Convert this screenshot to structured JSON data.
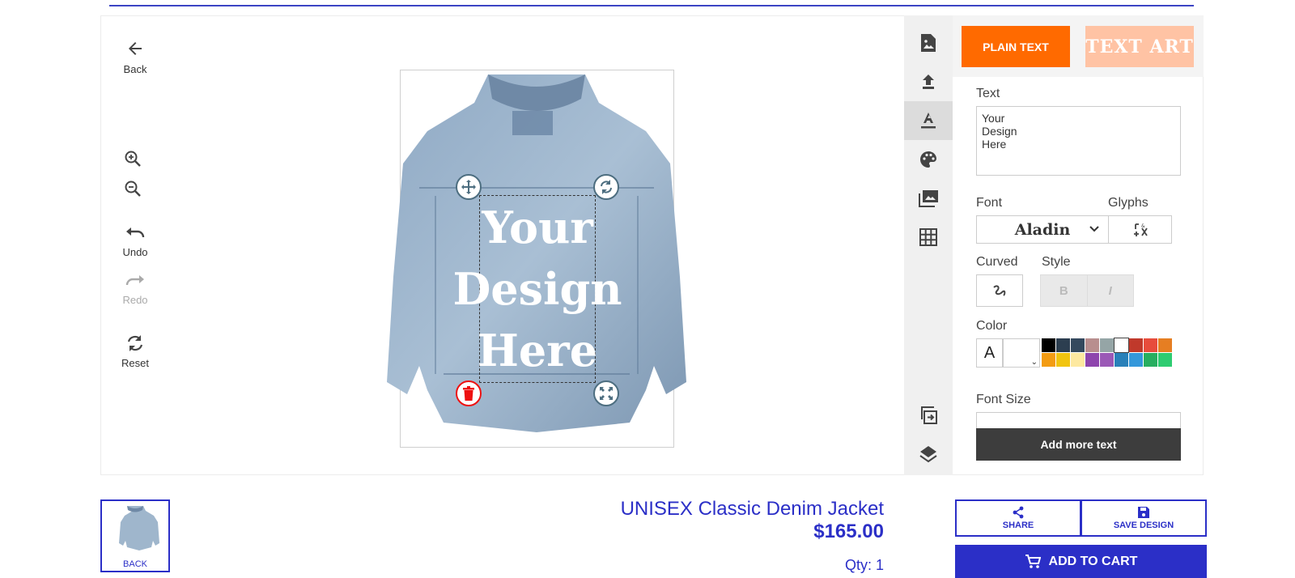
{
  "tools": {
    "back": "Back",
    "undo": "Undo",
    "redo": "Redo",
    "reset": "Reset"
  },
  "design": {
    "lines": [
      "Your",
      "Design",
      "Here"
    ]
  },
  "tabs": {
    "plain_text": "PLAIN TEXT",
    "text_art": "TEXT ART"
  },
  "editor": {
    "text_label": "Text",
    "text_value": "Your\nDesign\nHere",
    "font_label": "Font",
    "font_value": "Aladin",
    "glyphs_label": "Glyphs",
    "curved_label": "Curved",
    "style_label": "Style",
    "bold": "B",
    "italic": "I",
    "color_label": "Color",
    "color_letter": "A",
    "font_size_label": "Font Size",
    "add_more_text": "Add more text",
    "swatches": [
      "#000000",
      "#2c3e50",
      "#34495e",
      "#b88e8e",
      "#95a5a6",
      "#ffffff",
      "#c0392b",
      "#e74c3c",
      "#e67e22",
      "#f39c12",
      "#f1c40f",
      "#fde9a0",
      "#8e44ad",
      "#9b59b6",
      "#2980b9",
      "#3498db",
      "#27ae60",
      "#2ecc71"
    ]
  },
  "product": {
    "thumb_label": "BACK",
    "title": "UNISEX Classic Denim Jacket",
    "price": "$165.00",
    "qty": "Qty: 1"
  },
  "actions": {
    "share": "SHARE",
    "save": "SAVE DESIGN",
    "add_to_cart": "ADD TO CART"
  },
  "colors": {
    "accent": "#2b2fc7",
    "orange": "#ff6a00",
    "delete": "#e11"
  }
}
